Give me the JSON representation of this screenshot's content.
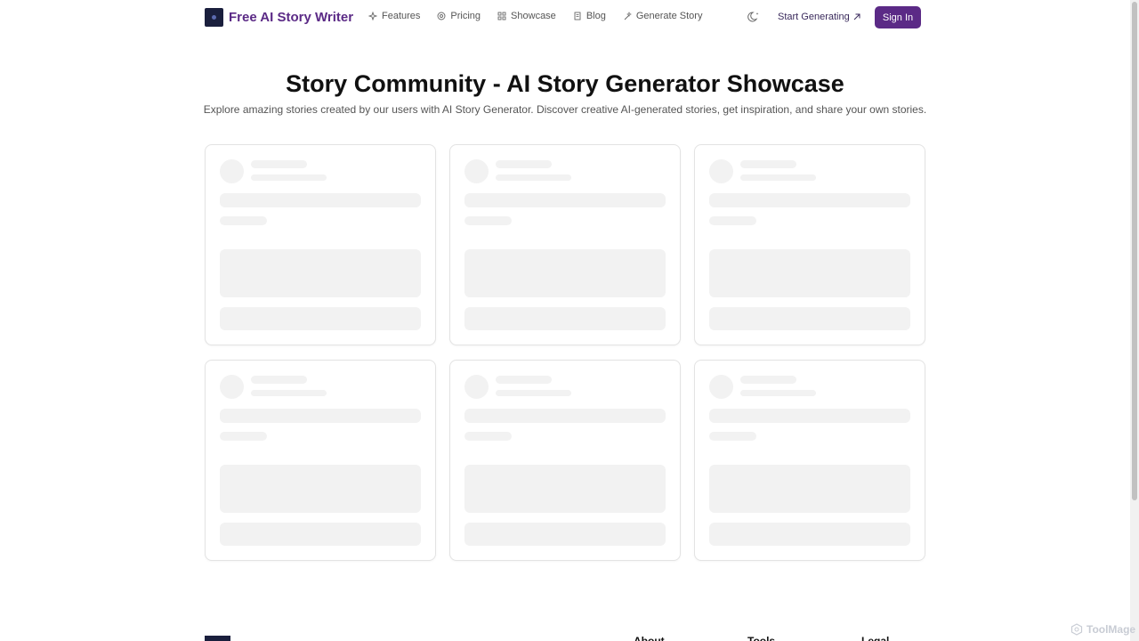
{
  "header": {
    "brand_name": "Free AI Story Writer",
    "nav": [
      {
        "label": "Features",
        "icon": "sparkles-icon"
      },
      {
        "label": "Pricing",
        "icon": "coin-icon"
      },
      {
        "label": "Showcase",
        "icon": "grid-icon"
      },
      {
        "label": "Blog",
        "icon": "document-icon"
      },
      {
        "label": "Generate Story",
        "icon": "wand-icon"
      }
    ],
    "start_label": "Start Generating",
    "start_icon": "arrow-up-right-icon",
    "theme_icon": "moon-icon",
    "sign_in_label": "Sign In"
  },
  "main": {
    "title": "Story Community - AI Story Generator Showcase",
    "subtitle": "Explore amazing stories created by our users with AI Story Generator. Discover creative AI-generated stories, get inspiration, and share your own stories."
  },
  "footer": {
    "columns": [
      "About",
      "Tools",
      "Legal"
    ]
  },
  "watermark": {
    "text": "ToolMage"
  },
  "colors": {
    "brand": "#5b2a86",
    "skeleton": "#f2f2f2",
    "card_border": "#e3e3e3"
  }
}
